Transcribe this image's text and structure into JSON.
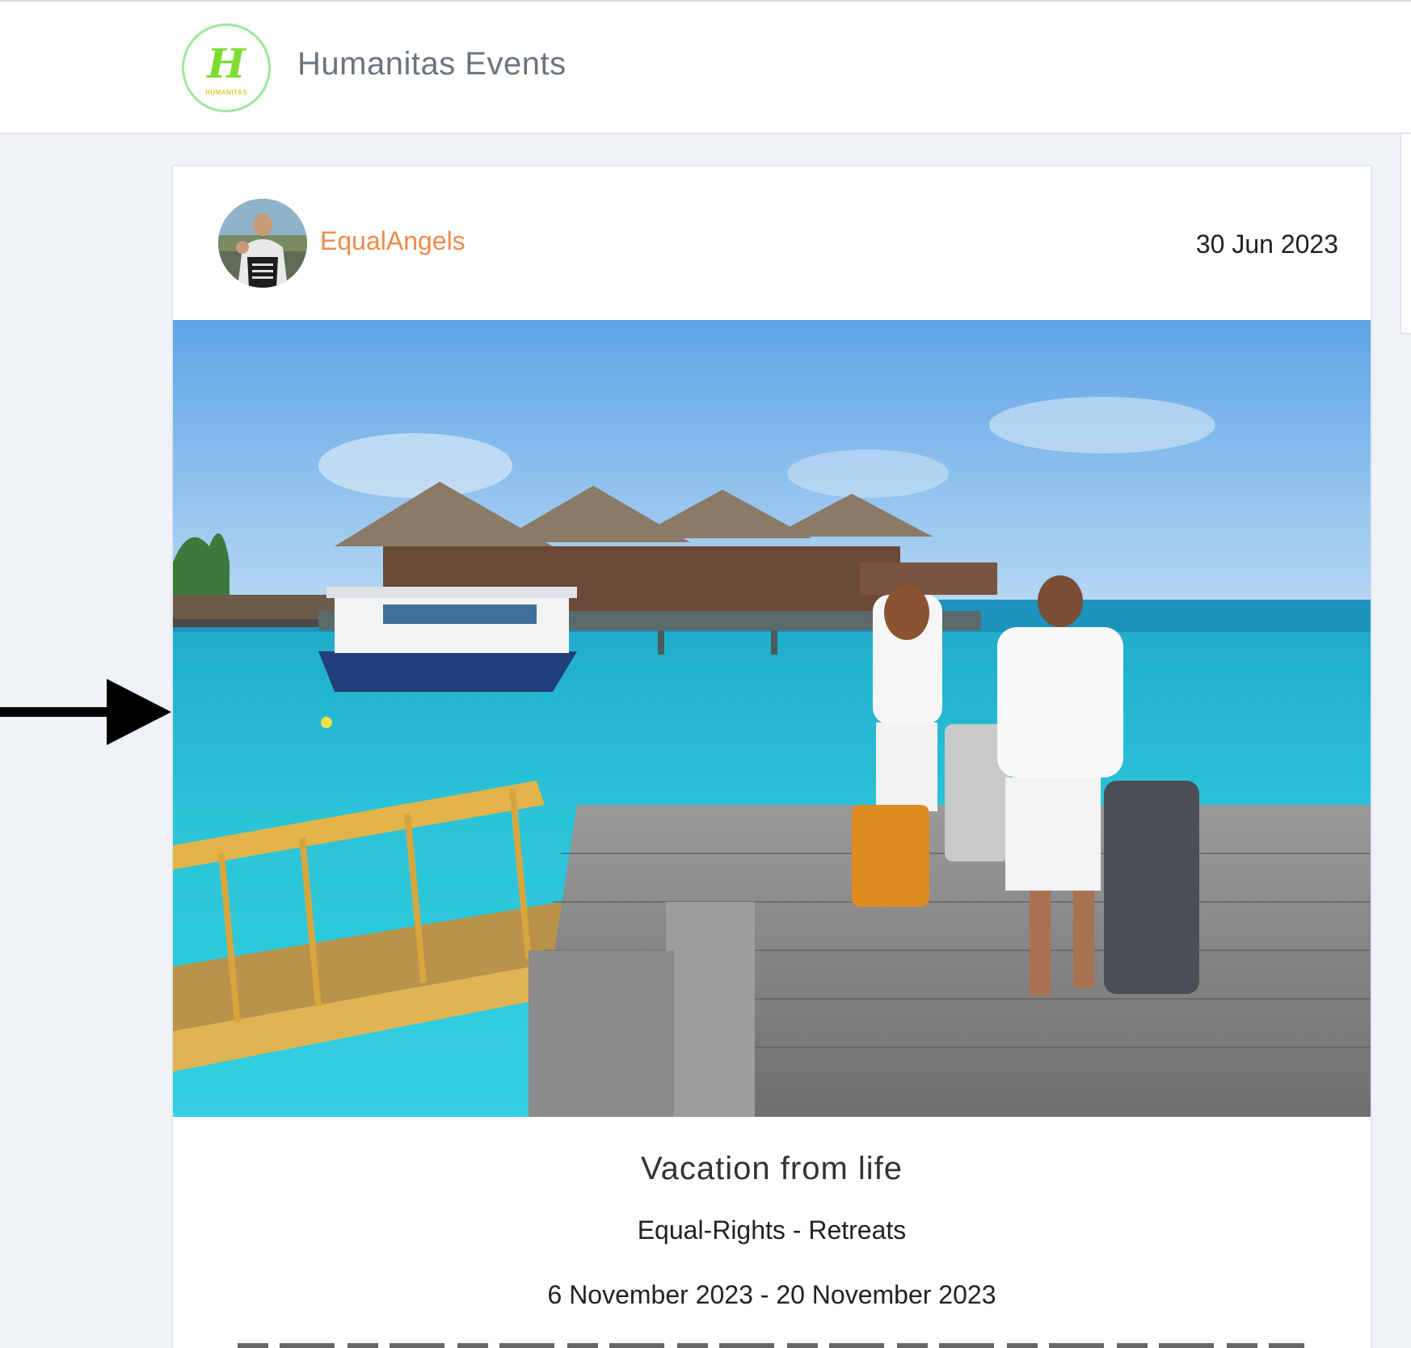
{
  "header": {
    "logo_letter": "H",
    "logo_text": "HUMANITAS",
    "site_title": "Humanitas Events"
  },
  "post": {
    "author": "EqualAngels",
    "date": "30 Jun 2023",
    "image_icon": "vacation-photo",
    "title": "Vacation from life",
    "category": "Equal-Rights - Retreats",
    "dates": "6 November 2023 - 20 November 2023"
  },
  "colors": {
    "author": "#f08a4b",
    "logo_ring": "#9be89b",
    "logo_letter": "#7ddc2f",
    "background": "#eff3f7"
  }
}
